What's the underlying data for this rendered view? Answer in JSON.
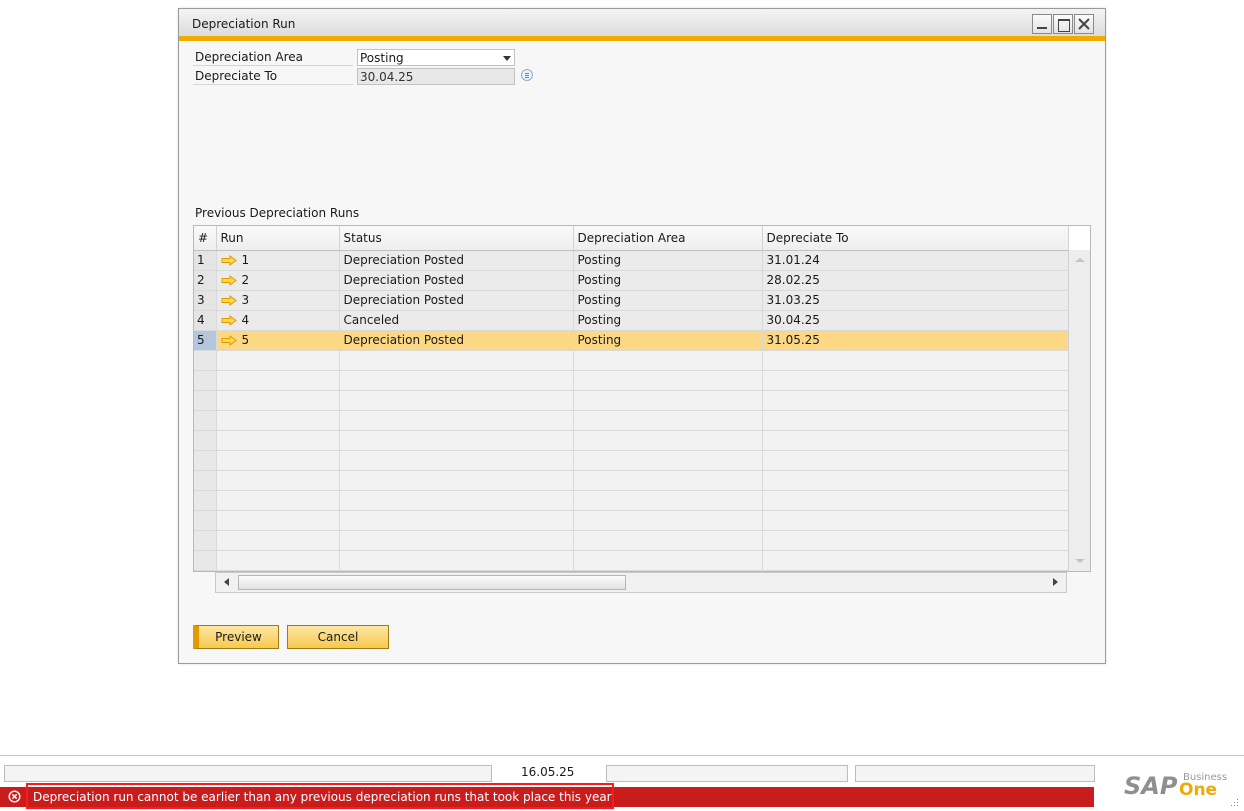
{
  "window": {
    "title": "Depreciation Run"
  },
  "form": {
    "depreciation_area_label": "Depreciation Area",
    "depreciation_area_value": "Posting",
    "depreciate_to_label": "Depreciate To",
    "depreciate_to_value": "30.04.25"
  },
  "grid": {
    "caption": "Previous Depreciation Runs",
    "columns": [
      "#",
      "Run",
      "Status",
      "Depreciation Area",
      "Depreciate To"
    ],
    "rows": [
      {
        "num": "1",
        "run": "1",
        "status": "Depreciation Posted",
        "area": "Posting",
        "to": "31.01.24"
      },
      {
        "num": "2",
        "run": "2",
        "status": "Depreciation Posted",
        "area": "Posting",
        "to": "28.02.25"
      },
      {
        "num": "3",
        "run": "3",
        "status": "Depreciation Posted",
        "area": "Posting",
        "to": "31.03.25"
      },
      {
        "num": "4",
        "run": "4",
        "status": "Canceled",
        "area": "Posting",
        "to": "30.04.25"
      },
      {
        "num": "5",
        "run": "5",
        "status": "Depreciation Posted",
        "area": "Posting",
        "to": "31.05.25"
      }
    ],
    "selected_row": 5,
    "empty_rows": 11
  },
  "buttons": {
    "preview": "Preview",
    "cancel": "Cancel"
  },
  "statusbar": {
    "date": "16.05.25",
    "error_message": "Depreciation run cannot be earlier than any previous depreciation runs that took place this year"
  },
  "branding": {
    "logo_main": "SAP",
    "logo_small": "Business",
    "logo_product": "One"
  },
  "colors": {
    "accent": "#f0ab00",
    "selected_row": "#fcd885",
    "error_bar": "#c91d1d",
    "error_highlight": "#ff1a1a"
  }
}
